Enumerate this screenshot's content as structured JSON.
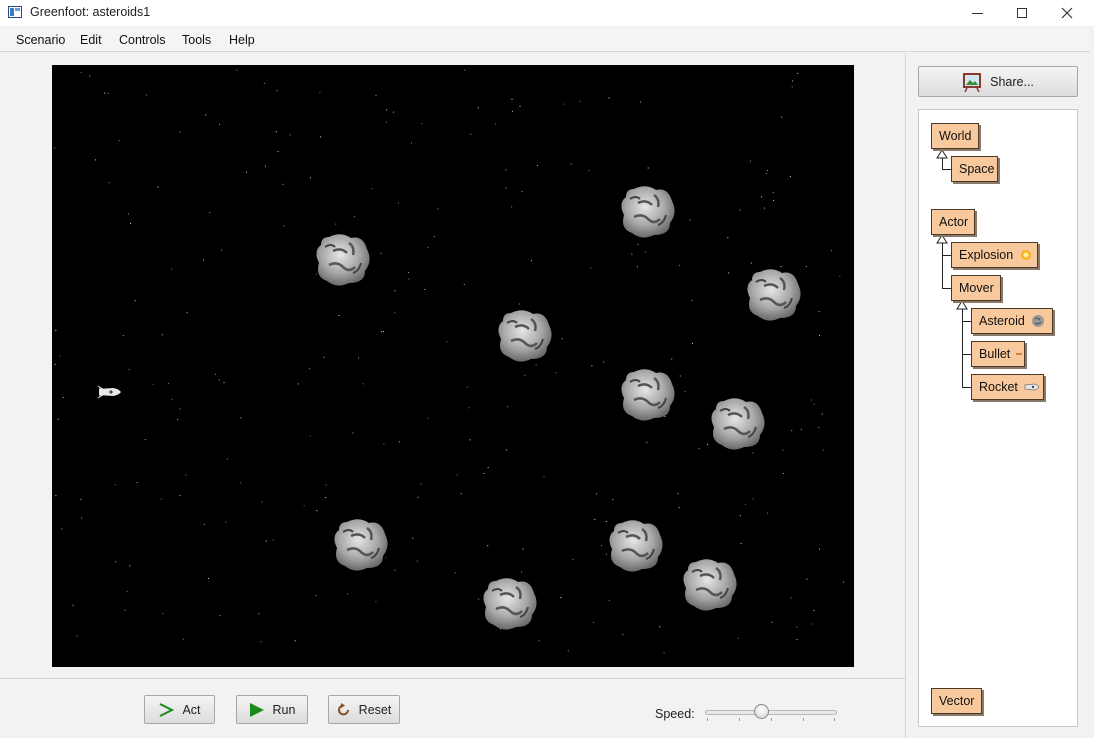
{
  "window": {
    "title": "Greenfoot: asteroids1"
  },
  "menu": [
    "Scenario",
    "Edit",
    "Controls",
    "Tools",
    "Help"
  ],
  "controls": {
    "act": "Act",
    "run": "Run",
    "reset": "Reset",
    "speed_label": "Speed:",
    "speed_value": 0.43
  },
  "share": {
    "label": "Share..."
  },
  "classes": {
    "world_root": "World",
    "world_sub": "Space",
    "actor_root": "Actor",
    "explosion": "Explosion",
    "mover": "Mover",
    "asteroid": "Asteroid",
    "bullet": "Bullet",
    "rocket": "Rocket",
    "other": "Vector"
  },
  "colors": {
    "class_fill": "#f8c99d",
    "world_bg": "#000000",
    "run_green": "#1a8a1a"
  },
  "icons": {
    "share": "picture-frame-icon",
    "act": "chevron-right-icon",
    "run": "play-icon",
    "reset": "reset-icon"
  }
}
